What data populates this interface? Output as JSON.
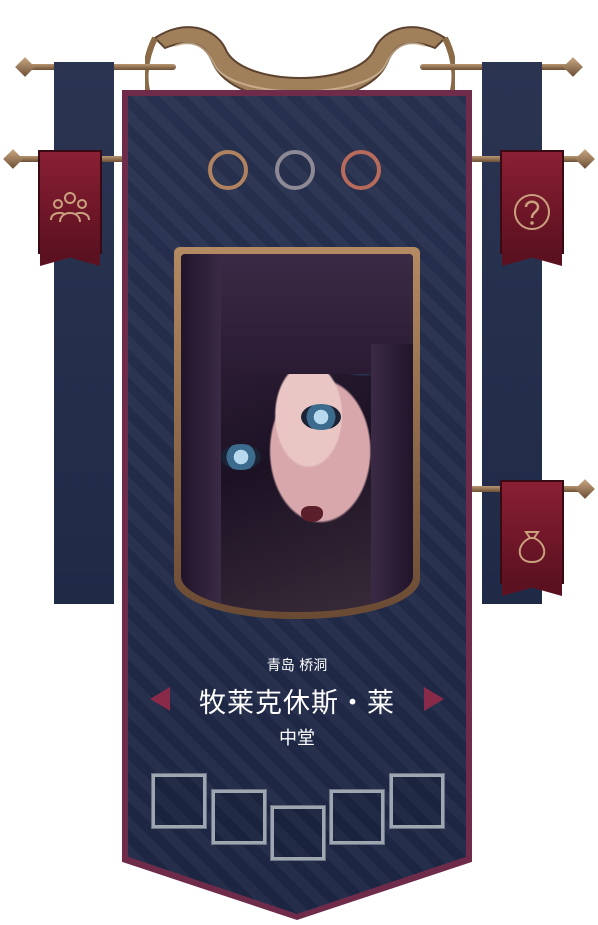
{
  "character": {
    "location": "青岛 桥洞",
    "name": "牧莱克休斯・莱",
    "role": "中堂"
  },
  "colors": {
    "banner_navy": "#283250",
    "banner_trim": "#6e2b4a",
    "flag_red": "#8a1f33",
    "gold": "#b48a62"
  },
  "rings": [
    {
      "color": "#b0825f"
    },
    {
      "color": "#8d8a95"
    },
    {
      "color": "#b86b5a"
    }
  ],
  "side_flags": {
    "left": {
      "icon": "group-icon"
    },
    "right_top": {
      "icon": "question-icon"
    },
    "right_bottom": {
      "icon": "bag-icon"
    }
  },
  "item_slots": 5
}
